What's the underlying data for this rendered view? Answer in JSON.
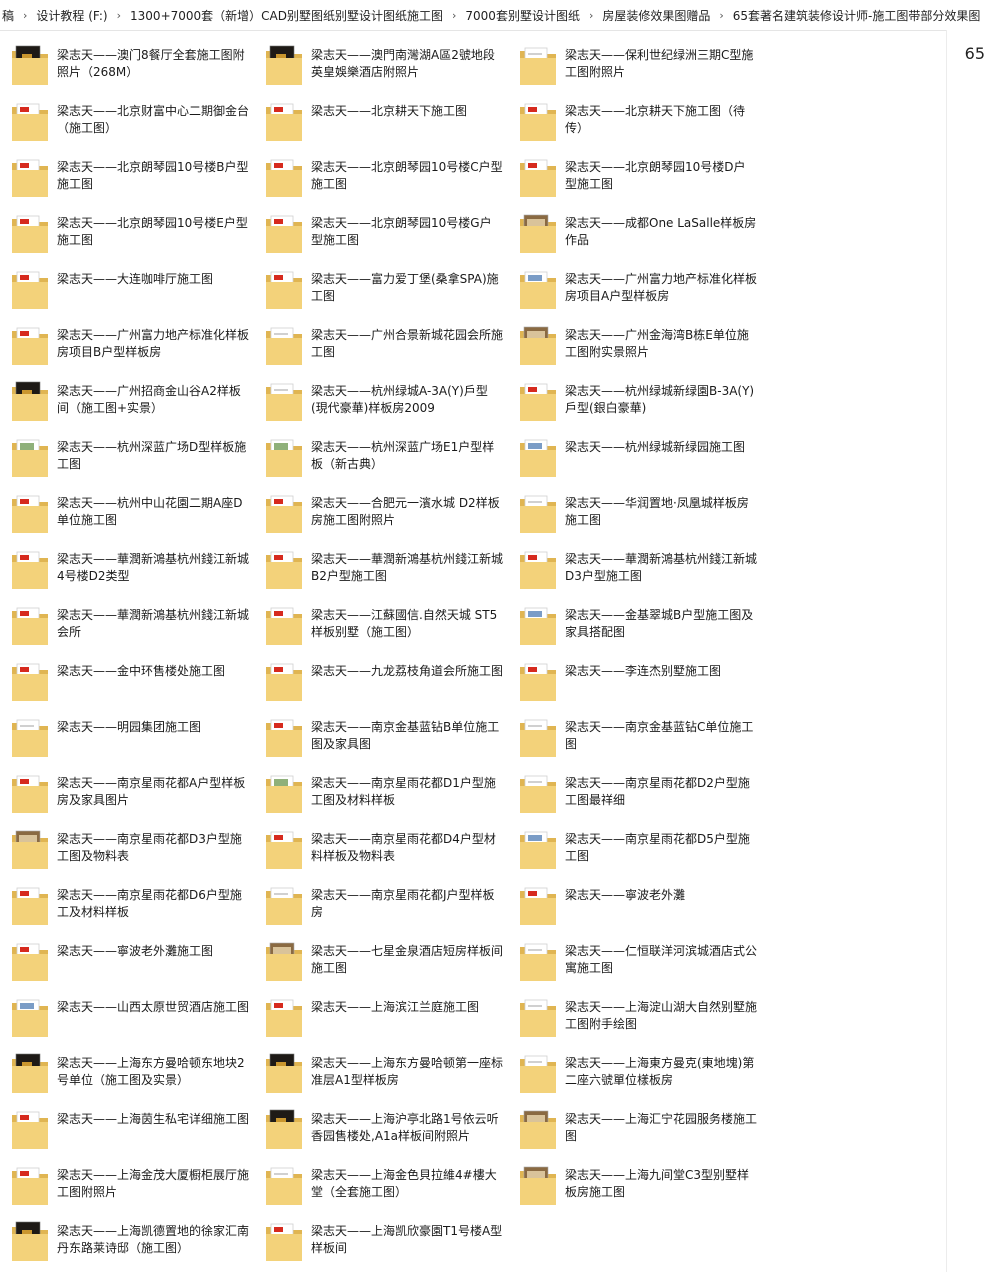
{
  "breadcrumb": [
    "稿",
    "设计教程 (F:)",
    "1300+7000套（新增）CAD别墅图纸别墅设计图纸施工图",
    "7000套别墅设计图纸",
    "房屋装修效果图赠品",
    "65套著名建筑装修设计师-施工图带部分效果图"
  ],
  "item_count": "65",
  "colors": {
    "folder": "#f3d27a",
    "folder_dark": "#e0b552",
    "accent": "#d62a1e"
  },
  "items": [
    {
      "name": "梁志天——澳门8餐厅全套施工图附照片（268M）",
      "thumb": "dark"
    },
    {
      "name": "梁志天——澳門南灣湖A區2號地段英皇娛樂酒店附照片",
      "thumb": "dark"
    },
    {
      "name": "梁志天——保利世纪绿洲三期C型施工图附照片",
      "thumb": "plain"
    },
    {
      "name": "梁志天——北京财富中心二期御金台（施工图）",
      "thumb": "red"
    },
    {
      "name": "梁志天——北京耕天下施工图",
      "thumb": "red"
    },
    {
      "name": "梁志天——北京耕天下施工图（待传）",
      "thumb": "red"
    },
    {
      "name": "梁志天——北京朗琴园10号楼B户型施工图",
      "thumb": "red"
    },
    {
      "name": "梁志天——北京朗琴园10号楼C户型施工图",
      "thumb": "red"
    },
    {
      "name": "梁志天——北京朗琴园10号楼D户型施工图",
      "thumb": "red"
    },
    {
      "name": "梁志天——北京朗琴园10号楼E户型施工图",
      "thumb": "red"
    },
    {
      "name": "梁志天——北京朗琴园10号楼G户型施工图",
      "thumb": "red"
    },
    {
      "name": "梁志天——成都One LaSalle样板房作品",
      "thumb": "photo"
    },
    {
      "name": "梁志天——大连咖啡厅施工图",
      "thumb": "red"
    },
    {
      "name": "梁志天——富力爱丁堡(桑拿SPA)施工图",
      "thumb": "red"
    },
    {
      "name": "梁志天——广州富力地产标准化样板房项目A户型样板房",
      "thumb": "blue"
    },
    {
      "name": "梁志天——广州富力地产标准化样板房项目B户型样板房",
      "thumb": "red"
    },
    {
      "name": "梁志天——广州合景新城花园会所施工图",
      "thumb": "plain"
    },
    {
      "name": "梁志天——广州金海湾B栋E单位施工图附实景照片",
      "thumb": "photo"
    },
    {
      "name": "梁志天——广州招商金山谷A2样板间（施工图+实景）",
      "thumb": "dark"
    },
    {
      "name": "梁志天——杭州绿城A-3A(Y)戶型(現代豪華)样板房2009",
      "thumb": "plain"
    },
    {
      "name": "梁志天——杭州绿城新绿園B-3A(Y)戶型(銀白豪華)",
      "thumb": "red"
    },
    {
      "name": "梁志天——杭州深蓝广场D型样板施工图",
      "thumb": "green"
    },
    {
      "name": "梁志天——杭州深蓝广场E1户型样板（新古典）",
      "thumb": "green"
    },
    {
      "name": "梁志天——杭州绿城新绿园施工图",
      "thumb": "blue"
    },
    {
      "name": "梁志天——杭州中山花園二期A座D单位施工图",
      "thumb": "red"
    },
    {
      "name": "梁志天——合肥元一濱水城 D2样板房施工图附照片",
      "thumb": "red"
    },
    {
      "name": "梁志天——华润置地·凤凰城样板房施工图",
      "thumb": "plain"
    },
    {
      "name": "梁志天——華潤新鴻基杭州錢江新城 4号楼D2类型",
      "thumb": "red"
    },
    {
      "name": "梁志天——華潤新鴻基杭州錢江新城 B2户型施工图",
      "thumb": "red"
    },
    {
      "name": "梁志天——華潤新鴻基杭州錢江新城 D3户型施工图",
      "thumb": "red"
    },
    {
      "name": "梁志天——華潤新鴻基杭州錢江新城会所",
      "thumb": "red"
    },
    {
      "name": "梁志天——江蘇國信.自然天城 ST5样板别墅（施工图）",
      "thumb": "red"
    },
    {
      "name": "梁志天——金基翠城B户型施工图及家具搭配图",
      "thumb": "blue"
    },
    {
      "name": "梁志天——金中环售楼处施工图",
      "thumb": "red"
    },
    {
      "name": "梁志天——九龙荔枝角道会所施工图",
      "thumb": "red"
    },
    {
      "name": "梁志天——李连杰别墅施工图",
      "thumb": "red"
    },
    {
      "name": "梁志天——明园集团施工图",
      "thumb": "plain"
    },
    {
      "name": "梁志天——南京金基蓝钻B单位施工图及家具图",
      "thumb": "red"
    },
    {
      "name": "梁志天——南京金基蓝钻C单位施工图",
      "thumb": "plain"
    },
    {
      "name": "梁志天——南京星雨花都A户型样板房及家具图片",
      "thumb": "red"
    },
    {
      "name": "梁志天——南京星雨花都D1户型施工图及材料样板",
      "thumb": "green"
    },
    {
      "name": "梁志天——南京星雨花都D2户型施工图最祥细",
      "thumb": "plain"
    },
    {
      "name": "梁志天——南京星雨花都D3户型施工图及物料表",
      "thumb": "photo"
    },
    {
      "name": "梁志天——南京星雨花都D4户型材料样板及物料表",
      "thumb": "red"
    },
    {
      "name": "梁志天——南京星雨花都D5户型施工图",
      "thumb": "blue"
    },
    {
      "name": "梁志天——南京星雨花都D6户型施工及材料样板",
      "thumb": "red"
    },
    {
      "name": "梁志天——南京星雨花都J户型样板房",
      "thumb": "plain"
    },
    {
      "name": "梁志天——寧波老外灘",
      "thumb": "red"
    },
    {
      "name": "梁志天——寧波老外灘施工图",
      "thumb": "red"
    },
    {
      "name": "梁志天——七星金泉酒店短房样板间施工图",
      "thumb": "photo"
    },
    {
      "name": "梁志天——仁恒联洋河滨城酒店式公寓施工图",
      "thumb": "plain"
    },
    {
      "name": "梁志天——山西太原世贸酒店施工图",
      "thumb": "blue"
    },
    {
      "name": "梁志天——上海滨江兰庭施工图",
      "thumb": "red"
    },
    {
      "name": "梁志天——上海淀山湖大自然别墅施工图附手绘图",
      "thumb": "plain"
    },
    {
      "name": "梁志天——上海东方曼哈顿东地块2号单位（施工图及实景）",
      "thumb": "dark"
    },
    {
      "name": "梁志天——上海东方曼哈顿第一座标准层A1型样板房",
      "thumb": "dark"
    },
    {
      "name": "梁志天——上海東方曼克(東地塊)第二座六號單位樣板房",
      "thumb": "plain"
    },
    {
      "name": "梁志天——上海茵生私宅详细施工图",
      "thumb": "red"
    },
    {
      "name": "梁志天——上海沪亭北路1号依云听香园售楼处,A1a样板间附照片",
      "thumb": "dark"
    },
    {
      "name": "梁志天——上海汇宁花园服务楼施工图",
      "thumb": "photo"
    },
    {
      "name": "梁志天——上海金茂大厦橱柜展厅施工图附照片",
      "thumb": "red"
    },
    {
      "name": "梁志天——上海金色貝拉維4#樓大堂（全套施工图）",
      "thumb": "plain"
    },
    {
      "name": "梁志天——上海九间堂C3型别墅样板房施工图",
      "thumb": "photo"
    },
    {
      "name": "梁志天——上海凯德置地的徐家汇南丹东路莱诗邸（施工图）",
      "thumb": "dark"
    },
    {
      "name": "梁志天——上海凯欣豪園T1号楼A型样板间",
      "thumb": "red"
    }
  ]
}
